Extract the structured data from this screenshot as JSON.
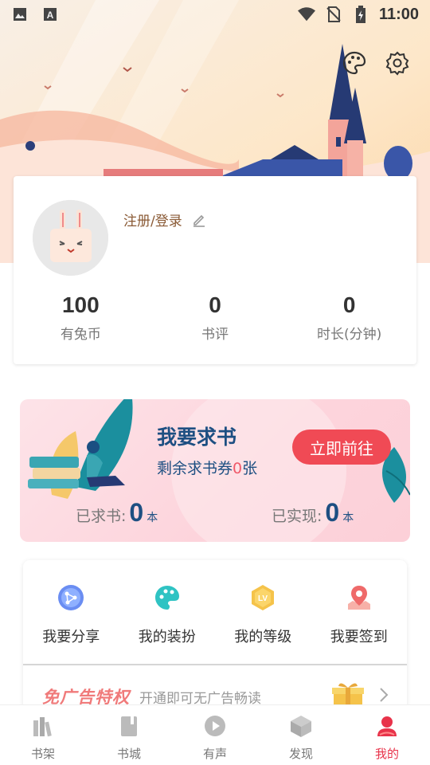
{
  "status_bar": {
    "time": "11:00"
  },
  "profile": {
    "login_label": "注册/登录",
    "stats": [
      {
        "value": "100",
        "label": "有兔币"
      },
      {
        "value": "0",
        "label": "书评"
      },
      {
        "value": "0",
        "label": "时长(分钟)"
      }
    ]
  },
  "request_book": {
    "title": "我要求书",
    "subtitle_prefix": "剩余求书券",
    "subtitle_count": "0",
    "subtitle_suffix": "张",
    "go_label": "立即前往",
    "requested_label": "已求书:",
    "requested_value": "0",
    "requested_unit": "本",
    "realized_label": "已实现:",
    "realized_value": "0",
    "realized_unit": "本"
  },
  "features": {
    "items": [
      {
        "label": "我要分享",
        "icon": "share-icon"
      },
      {
        "label": "我的装扮",
        "icon": "palette-icon"
      },
      {
        "label": "我的等级",
        "icon": "level-badge-icon"
      },
      {
        "label": "我要签到",
        "icon": "checkin-location-icon"
      }
    ],
    "adfree_title": "免广告特权",
    "adfree_desc": "开通即可无广告畅读"
  },
  "nav": {
    "items": [
      {
        "label": "书架",
        "icon": "bookshelf-icon"
      },
      {
        "label": "书城",
        "icon": "bookstore-icon"
      },
      {
        "label": "有声",
        "icon": "audio-play-icon"
      },
      {
        "label": "发现",
        "icon": "discover-cube-icon"
      },
      {
        "label": "我的",
        "icon": "profile-icon"
      }
    ],
    "active_index": 4
  },
  "colors": {
    "accent": "#e8334a",
    "navy": "#1d4f82",
    "button_red": "#f04a55"
  }
}
